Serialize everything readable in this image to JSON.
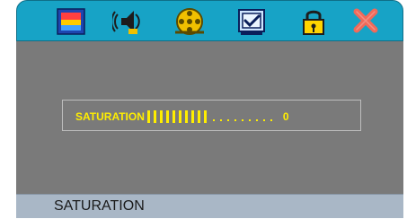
{
  "menu": {
    "icons": [
      "picture-icon",
      "audio-icon",
      "film-reel-icon",
      "checkbox-icon",
      "lock-icon",
      "close-icon"
    ],
    "colors": {
      "bar": "#17a3c6",
      "picture_frame": "#1d46b0",
      "audio": "#1d1d1d",
      "reel": "#f0c000",
      "lock": "#ffd400",
      "close": "#f06a5a"
    }
  },
  "adjust": {
    "label": "SATURATION",
    "value": "0",
    "filled_steps": 10,
    "total_steps": 19,
    "color": "#ffee00"
  },
  "status": {
    "text": "SATURATION"
  }
}
